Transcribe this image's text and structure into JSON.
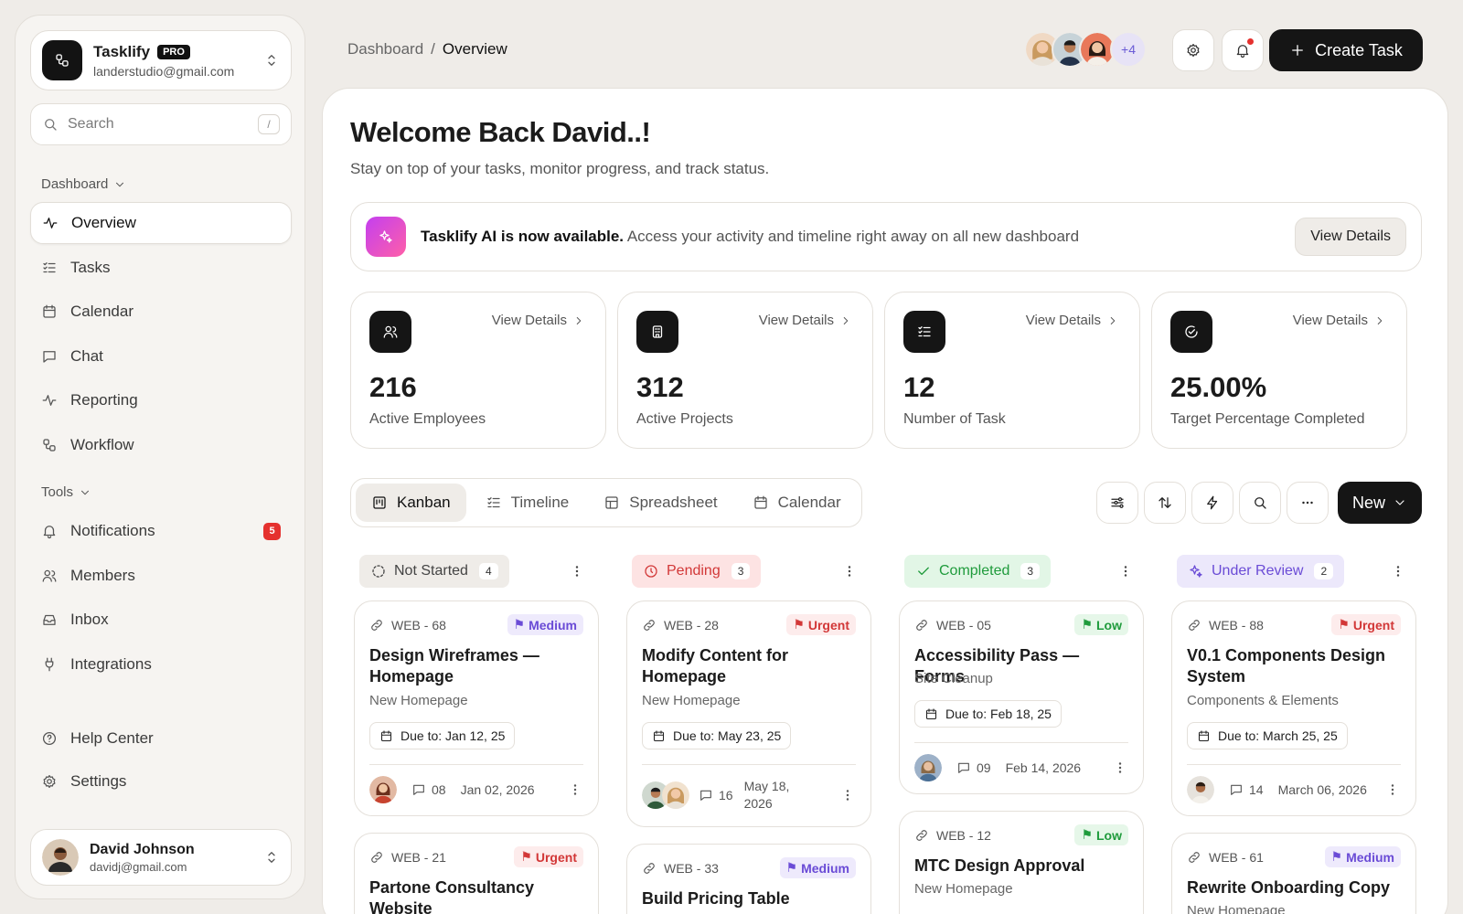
{
  "workspace": {
    "name": "Tasklify",
    "badge": "PRO",
    "email": "landerstudio@gmail.com"
  },
  "search": {
    "placeholder": "Search",
    "shortcut": "/"
  },
  "sidebar": {
    "section_dashboard": "Dashboard",
    "nav": [
      {
        "label": "Overview",
        "icon": "activity-icon"
      },
      {
        "label": "Tasks",
        "icon": "list-check-icon"
      },
      {
        "label": "Calendar",
        "icon": "calendar-icon"
      },
      {
        "label": "Chat",
        "icon": "chat-icon"
      },
      {
        "label": "Reporting",
        "icon": "pulse-icon"
      },
      {
        "label": "Workflow",
        "icon": "workflow-icon"
      }
    ],
    "section_tools": "Tools",
    "tools": [
      {
        "label": "Notifications",
        "icon": "bell-icon",
        "badge": "5"
      },
      {
        "label": "Members",
        "icon": "users-icon"
      },
      {
        "label": "Inbox",
        "icon": "inbox-icon"
      },
      {
        "label": "Integrations",
        "icon": "plug-icon"
      }
    ],
    "bottom": [
      {
        "label": "Help Center",
        "icon": "help-icon"
      },
      {
        "label": "Settings",
        "icon": "gear-icon"
      }
    ]
  },
  "user": {
    "name": "David Johnson",
    "email": "davidj@gmail.com"
  },
  "breadcrumb": {
    "root": "Dashboard",
    "sep": "/",
    "current": "Overview"
  },
  "header": {
    "more_members": "+4",
    "create_label": "Create Task"
  },
  "welcome": {
    "title": "Welcome Back David..!",
    "subtitle": "Stay on top of your tasks, monitor progress, and track status."
  },
  "banner": {
    "bold": "Tasklify AI is now available.",
    "text": "Access your activity and timeline right away on all new dashboard",
    "button": "View Details"
  },
  "stats": [
    {
      "value": "216",
      "label": "Active Employees",
      "link": "View Details"
    },
    {
      "value": "312",
      "label": "Active Projects",
      "link": "View Details"
    },
    {
      "value": "12",
      "label": "Number of Task",
      "link": "View Details"
    },
    {
      "value": "25.00%",
      "label": "Target Percentage Completed",
      "link": "View Details"
    }
  ],
  "view_tabs": [
    "Kanban",
    "Timeline",
    "Spreadsheet",
    "Calendar"
  ],
  "new_label": "New",
  "columns": [
    {
      "title": "Not Started",
      "count": "4",
      "bg": "#efece8",
      "fg": "#444444"
    },
    {
      "title": "Pending",
      "count": "3",
      "bg": "#fde3e3",
      "fg": "#d23737"
    },
    {
      "title": "Completed",
      "count": "3",
      "bg": "#e2f6e6",
      "fg": "#1f9b3c"
    },
    {
      "title": "Under Review",
      "count": "2",
      "bg": "#ece8fb",
      "fg": "#6a4bd6"
    }
  ],
  "tasks": [
    {
      "code": "WEB - 68",
      "priority": "Medium",
      "title": "Design Wireframes — Homepage",
      "sub": "New Homepage",
      "due": "Due to: Jan 12, 25",
      "comments": "08",
      "date": "Jan 02, 2026"
    },
    {
      "code": "WEB - 28",
      "priority": "Urgent",
      "title": "Modify Content for Homepage",
      "sub": "New Homepage",
      "due": "Due to: May 23, 25",
      "comments": "16",
      "date": "May 18, 2026"
    },
    {
      "code": "WEB - 05",
      "priority": "Low",
      "title": "Accessibility Pass — Forms",
      "sub": "Site Cleanup",
      "due": "Due to: Feb 18, 25",
      "comments": "09",
      "date": "Feb 14, 2026"
    },
    {
      "code": "WEB - 88",
      "priority": "Urgent",
      "title": "V0.1 Components Design System",
      "sub": "Components & Elements",
      "due": "Due to: March 25, 25",
      "comments": "14",
      "date": "March 06, 2026"
    },
    {
      "code": "WEB - 21",
      "priority": "Urgent",
      "title": "Partone Consultancy Website",
      "sub": ""
    },
    {
      "code": "WEB - 33",
      "priority": "Medium",
      "title": "Build Pricing Table",
      "sub": ""
    },
    {
      "code": "WEB - 12",
      "priority": "Low",
      "title": "MTC Design Approval",
      "sub": "New Homepage"
    },
    {
      "code": "WEB - 61",
      "priority": "Medium",
      "title": "Rewrite Onboarding Copy",
      "sub": "New Homepage"
    }
  ],
  "colors": {
    "accent": "#151515",
    "background": "#efece8",
    "danger": "#e5312e"
  }
}
